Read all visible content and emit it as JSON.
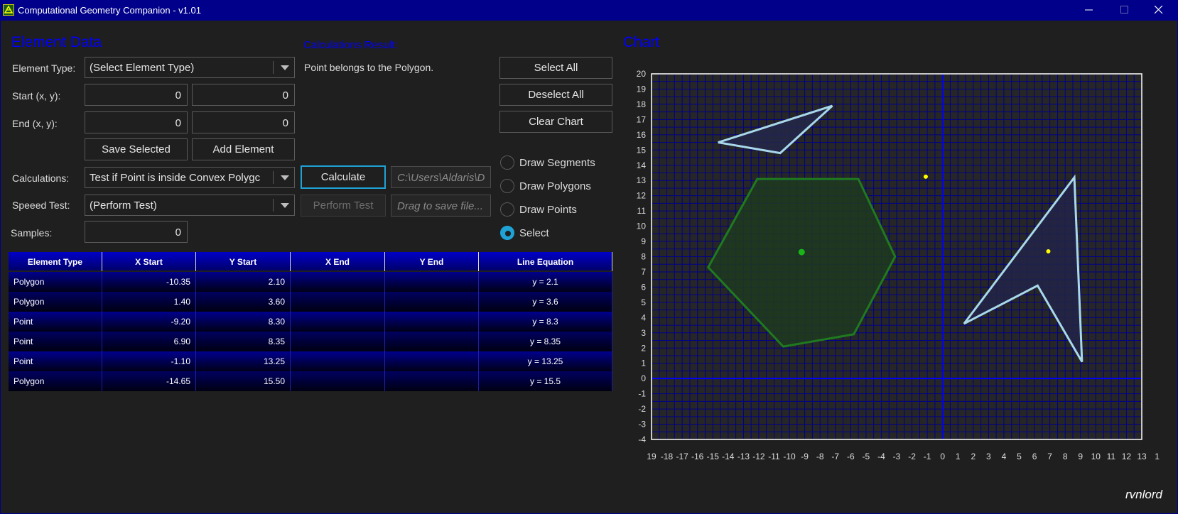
{
  "window": {
    "title": "Computational Geometry Companion - v1.01",
    "colors": {
      "titlebar": "#00008b",
      "background": "#1f1f1f",
      "accent": "#1fa3d6",
      "heading": "#0000ff"
    },
    "icons": [
      "app-icon",
      "minimize-icon",
      "maximize-icon",
      "close-icon"
    ]
  },
  "element_data": {
    "heading": "Element Data",
    "element_type_label": "Element Type:",
    "element_type_value": "(Select Element Type)",
    "start_label": "Start (x, y):",
    "start_x": "0",
    "start_y": "0",
    "end_label": "End (x, y):",
    "end_x": "0",
    "end_y": "0",
    "save_selected": "Save Selected",
    "add_element": "Add Element",
    "calculations_label": "Calculations:",
    "calculations_value": "Test if Point is inside Convex Polygc",
    "speed_test_label": "Speeed Test:",
    "speed_test_value": "(Perform Test)",
    "samples_label": "Samples:",
    "samples_value": "0"
  },
  "calc": {
    "heading": "Calculations Result:",
    "result_text": "Point belongs to the Polygon.",
    "calculate": "Calculate",
    "perform_test": "Perform Test",
    "path_text": "C:\\Users\\Aldaris\\D",
    "drag_text": "Drag to save file..."
  },
  "actions": {
    "select_all": "Select All",
    "deselect_all": "Deselect All",
    "clear_chart": "Clear Chart"
  },
  "modes": [
    {
      "label": "Draw Segments",
      "checked": false
    },
    {
      "label": "Draw Polygons",
      "checked": false
    },
    {
      "label": "Draw Points",
      "checked": false
    },
    {
      "label": "Select",
      "checked": true
    }
  ],
  "table": {
    "columns": [
      "Element Type",
      "X Start",
      "Y Start",
      "X End",
      "Y End",
      "Line Equation"
    ],
    "rows": [
      [
        "Polygon",
        "-10.35",
        "2.10",
        "",
        "",
        "y = 2.1"
      ],
      [
        "Polygon",
        "1.40",
        "3.60",
        "",
        "",
        "y = 3.6"
      ],
      [
        "Point",
        "-9.20",
        "8.30",
        "",
        "",
        "y = 8.3"
      ],
      [
        "Point",
        "6.90",
        "8.35",
        "",
        "",
        "y = 8.35"
      ],
      [
        "Point",
        "-1.10",
        "13.25",
        "",
        "",
        "y = 13.25"
      ],
      [
        "Polygon",
        "-14.65",
        "15.50",
        "",
        "",
        "y = 15.5"
      ]
    ]
  },
  "chart": {
    "heading": "Chart",
    "signature": "rvnlord"
  },
  "chart_data": {
    "type": "scatter",
    "x_ticks": [
      "19",
      "-18",
      "-17",
      "-16",
      "-15",
      "-14",
      "-13",
      "-12",
      "-11",
      "-10",
      "-9",
      "-8",
      "-7",
      "-6",
      "-5",
      "-4",
      "-3",
      "-2",
      "-1",
      "0",
      "1",
      "2",
      "3",
      "4",
      "5",
      "6",
      "7",
      "8",
      "9",
      "10",
      "11",
      "12",
      "13",
      "1"
    ],
    "y_ticks": [
      "20",
      "19",
      "18",
      "17",
      "16",
      "15",
      "14",
      "13",
      "12",
      "11",
      "10",
      "9",
      "8",
      "7",
      "6",
      "5",
      "4",
      "3",
      "2",
      "1",
      "0",
      "-1",
      "-2",
      "-3",
      "-4"
    ],
    "xlim": [
      -19,
      13
    ],
    "ylim": [
      -4,
      20
    ],
    "grid": true,
    "polygons": [
      {
        "points": [
          [
            -15.3,
            7.3
          ],
          [
            -12.1,
            13.1
          ],
          [
            -5.5,
            13.1
          ],
          [
            -3.1,
            8.0
          ],
          [
            -5.8,
            2.9
          ],
          [
            -10.4,
            2.1
          ]
        ],
        "stroke": "#1f7a1f",
        "fill": "#1f3a1f"
      },
      {
        "points": [
          [
            -14.65,
            15.5
          ],
          [
            -7.2,
            17.9
          ],
          [
            -10.6,
            14.8
          ]
        ],
        "stroke": "#a8d8ea",
        "fill": "#242848"
      },
      {
        "points": [
          [
            1.4,
            3.6
          ],
          [
            8.6,
            13.2
          ],
          [
            9.1,
            1.1
          ],
          [
            6.2,
            6.1
          ]
        ],
        "stroke": "#a8d8ea",
        "fill": "#222546"
      }
    ],
    "points": [
      {
        "x": -9.2,
        "y": 8.3,
        "color": "#18b418",
        "size": "large"
      },
      {
        "x": 6.9,
        "y": 8.35,
        "color": "#ffff00",
        "size": "small"
      },
      {
        "x": -1.1,
        "y": 13.25,
        "color": "#ffff00",
        "size": "small"
      }
    ],
    "colors": {
      "axes": "#0000ff",
      "grid": "#00008b",
      "plot_bg": "#262626",
      "frame": "#ffffff"
    }
  }
}
